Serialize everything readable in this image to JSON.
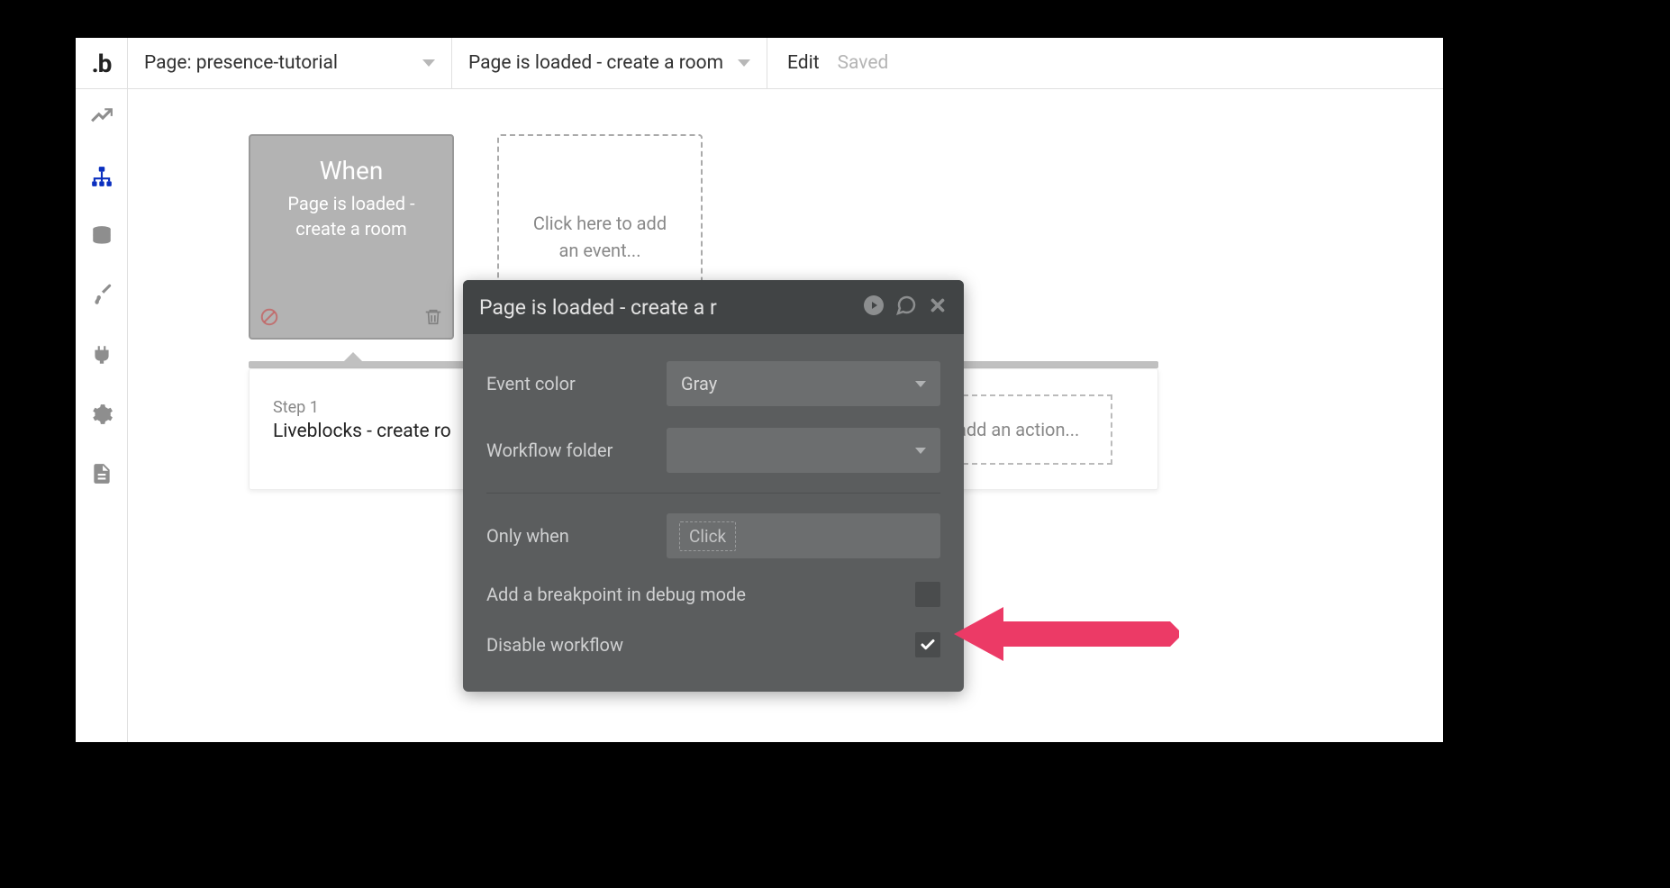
{
  "logo": ".b",
  "topbar": {
    "page_dropdown": "Page: presence-tutorial",
    "workflow_dropdown": "Page is loaded - create a room",
    "edit": "Edit",
    "saved": "Saved"
  },
  "canvas": {
    "event_card": {
      "when": "When",
      "desc": "Page is loaded - create a room"
    },
    "add_event": "Click here to add an event...",
    "step": {
      "label": "Step 1",
      "title": "Liveblocks - create ro"
    },
    "add_action": "o add an action..."
  },
  "popup": {
    "title": "Page is loaded - create a r",
    "rows": {
      "event_color": {
        "label": "Event color",
        "value": "Gray"
      },
      "workflow_folder": {
        "label": "Workflow folder",
        "value": ""
      },
      "only_when": {
        "label": "Only when",
        "placeholder": "Click"
      },
      "breakpoint": {
        "label": "Add a breakpoint in debug mode"
      },
      "disable": {
        "label": "Disable workflow"
      }
    }
  },
  "annotation": {
    "arrow_color": "#ec3a66"
  }
}
